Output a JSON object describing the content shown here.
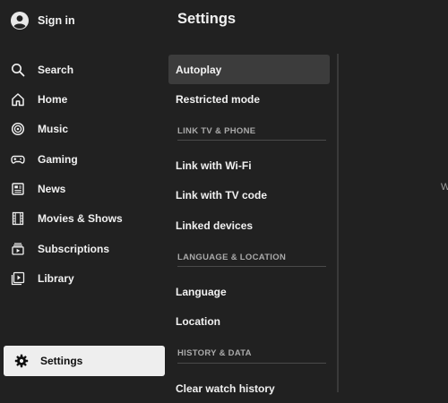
{
  "header": {
    "sign_in_label": "Sign in",
    "page_title": "Settings"
  },
  "nav": {
    "items": [
      {
        "label": "Search",
        "icon": "search-icon"
      },
      {
        "label": "Home",
        "icon": "home-icon"
      },
      {
        "label": "Music",
        "icon": "music-icon"
      },
      {
        "label": "Gaming",
        "icon": "gamepad-icon"
      },
      {
        "label": "News",
        "icon": "news-icon"
      },
      {
        "label": "Movies & Shows",
        "icon": "film-icon"
      },
      {
        "label": "Subscriptions",
        "icon": "subscriptions-icon"
      },
      {
        "label": "Library",
        "icon": "library-icon"
      }
    ],
    "settings_label": "Settings"
  },
  "settings_menu": {
    "items": {
      "autoplay": "Autoplay",
      "restricted_mode": "Restricted mode",
      "link_wifi": "Link with Wi-Fi",
      "link_tv_code": "Link with TV code",
      "linked_devices": "Linked devices",
      "language": "Language",
      "location": "Location",
      "clear_watch_history": "Clear watch history"
    },
    "sections": {
      "link": "LINK TV & PHONE",
      "language_location": "LANGUAGE & LOCATION",
      "history_data": "HISTORY & DATA"
    }
  },
  "right_panel": {
    "clipped_text": "W"
  },
  "colors": {
    "background": "#212121",
    "selected_item": "#3c3c3c",
    "active_nav_bg": "#eeeeee",
    "text": "#f1f1f1",
    "section_text": "#aaaaaa"
  }
}
